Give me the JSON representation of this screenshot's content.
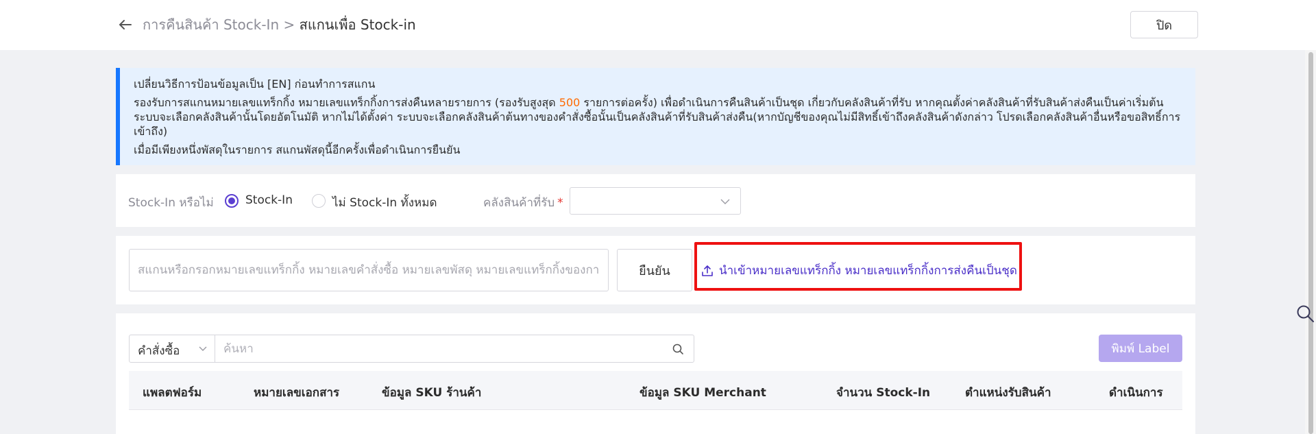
{
  "header": {
    "breadcrumb_parent": "การคืนสินค้า Stock-In",
    "breadcrumb_sep": ">",
    "breadcrumb_current": "สแกนเพื่อ Stock-in",
    "close_label": "ปิด",
    "back_icon": "arrow-left-icon"
  },
  "notice": {
    "line1": "เปลี่ยนวิธีการป้อนข้อมูลเป็น [EN] ก่อนทำการสแกน",
    "line2_before": "รองรับการสแกนหมายเลขแทร็กกิ้ง หมายเลขแทร็กกิ้งการส่งคืนหลายรายการ (รองรับสูงสุด ",
    "line2_highlight": "500",
    "line2_after": " รายการต่อครั้ง) เพื่อดำเนินการคืนสินค้าเป็นชุด เกี่ยวกับคลังสินค้าที่รับ หากคุณตั้งค่าคลังสินค้าที่รับสินค้าส่งคืนเป็นค่าเริ่มต้น ระบบจะเลือกคลังสินค้านั้นโดยอัตโนมัติ หากไม่ได้ตั้งค่า ระบบจะเลือกคลังสินค้าต้นทางของคำสั่งซื้อนั้นเป็นคลังสินค้าที่รับสินค้าส่งคืน(หากบัญชีของคุณไม่มีสิทธิ์เข้าถึงคลังสินค้าดังกล่าว โปรดเลือกคลังสินค้าอื่นหรือขอสิทธิ์การเข้าถึง)",
    "line3": "เมื่อมีเพียงหนึ่งพัสดุในรายการ สแกนพัสดุนี้อีกครั้งเพื่อดำเนินการยืนยัน",
    "highlight_color": "#ff6a00"
  },
  "stock_in": {
    "label": "Stock-In หรือไม่",
    "option_yes": "Stock-In",
    "option_no": "ไม่ Stock-In ทั้งหมด",
    "selected": "Stock-In",
    "warehouse_label": "คลังสินค้าที่รับ",
    "required_mark": "*",
    "warehouse_value": ""
  },
  "scan": {
    "placeholder": "สแกนหรือกรอกหมายเลขแทร็กกิ้ง หมายเลขคำสั่งซื้อ หมายเลขพัสดุ หมายเลขแทร็กกิ้งของการส่งคืน",
    "confirm_label": "ยืนยัน",
    "import_label": "นำเข้าหมายเลขแทร็กกิ้ง หมายเลขแทร็กกิ้งการส่งคืนเป็นชุด",
    "import_icon": "upload-icon"
  },
  "table": {
    "filter_selected": "คำสั่งซื้อ",
    "search_placeholder": "ค้นหา",
    "print_label": "พิมพ์ Label",
    "columns": [
      "แพลตฟอร์ม",
      "หมายเลขเอกสาร",
      "ข้อมูล SKU ร้านค้า",
      "ข้อมูล SKU Merchant",
      "จำนวน Stock-In",
      "ตำแหน่งรับสินค้า",
      "ดำเนินการ"
    ]
  },
  "colors": {
    "accent": "#5b3fd1",
    "link": "#4a2fc8",
    "notice_bg": "#e6f1fe",
    "notice_border": "#1677ff",
    "highlight_box": "#ee1111",
    "print_button_disabled": "#b5a7ef"
  }
}
